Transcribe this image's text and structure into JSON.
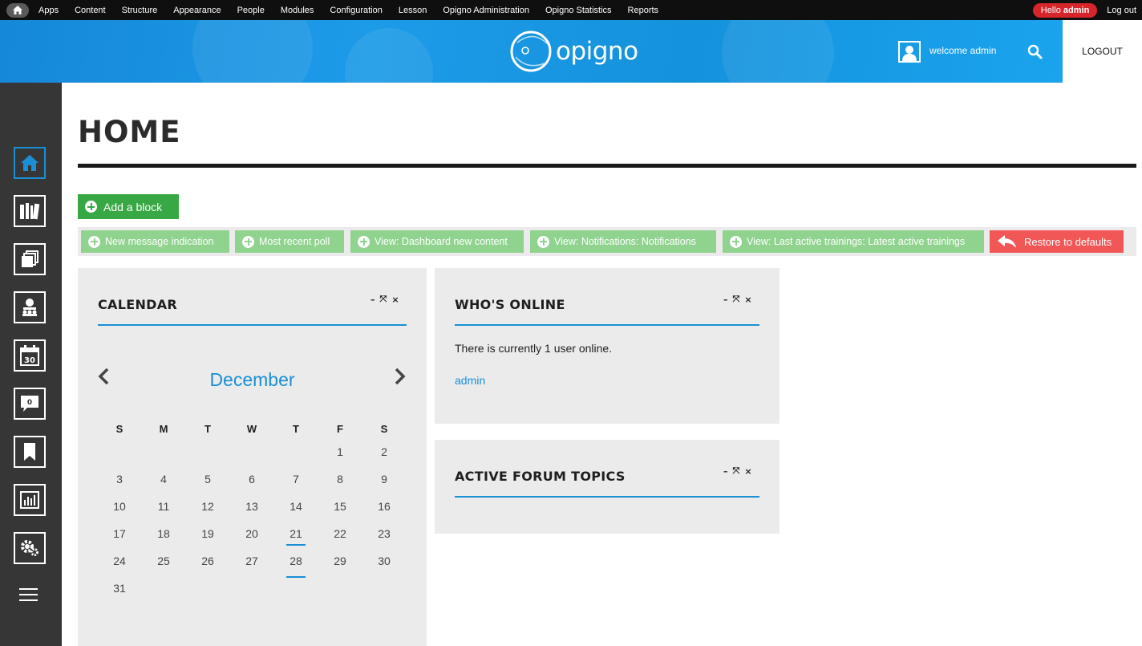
{
  "admin_bar": {
    "items": [
      "Apps",
      "Content",
      "Structure",
      "Appearance",
      "People",
      "Modules",
      "Configuration",
      "Lesson",
      "Opigno Administration",
      "Opigno Statistics",
      "Reports"
    ],
    "hello_prefix": "Hello",
    "hello_user": "admin",
    "logout": "Log out"
  },
  "header": {
    "logo_text": "opigno",
    "welcome": "welcome admin",
    "logout": "LOGOUT"
  },
  "sidebar": {
    "icons": [
      "home-icon",
      "library-icon",
      "documents-icon",
      "classroom-icon",
      "calendar-30-icon",
      "messages-icon",
      "bookmark-icon",
      "statistics-icon",
      "settings-icon",
      "hamburger-icon"
    ],
    "calendar_day": "30",
    "message_count": "0"
  },
  "main": {
    "title": "HOME",
    "add_block": "Add a block",
    "blocks": [
      "New message indication",
      "Most recent poll",
      "View: Dashboard new content",
      "View: Notifications: Notifications",
      "View: Last active trainings: Latest active trainings"
    ],
    "restore": "Restore to defaults"
  },
  "calendar": {
    "title": "CALENDAR",
    "month": "December",
    "weekdays": [
      "S",
      "M",
      "T",
      "W",
      "T",
      "F",
      "S"
    ],
    "weeks": [
      [
        "",
        "",
        "",
        "",
        "",
        "1",
        "2"
      ],
      [
        "3",
        "4",
        "5",
        "6",
        "7",
        "8",
        "9"
      ],
      [
        "10",
        "11",
        "12",
        "13",
        "14",
        "15",
        "16"
      ],
      [
        "17",
        "18",
        "19",
        "20",
        "21",
        "22",
        "23"
      ],
      [
        "24",
        "25",
        "26",
        "27",
        "28",
        "29",
        "30"
      ],
      [
        "31",
        "",
        "",
        "",
        "",
        "",
        ""
      ]
    ],
    "today": "28"
  },
  "whos_online": {
    "title": "WHO'S ONLINE",
    "text": "There is currently 1 user online.",
    "user": "admin"
  },
  "forum": {
    "title": "ACTIVE FORUM TOPICS"
  },
  "panel_controls": [
    "–",
    "⤧",
    "×"
  ],
  "colors": {
    "accent": "#1a8fd6",
    "green": "#37a843",
    "light_green": "#8fd38f",
    "red": "#f25757",
    "sidebar": "#363636"
  }
}
